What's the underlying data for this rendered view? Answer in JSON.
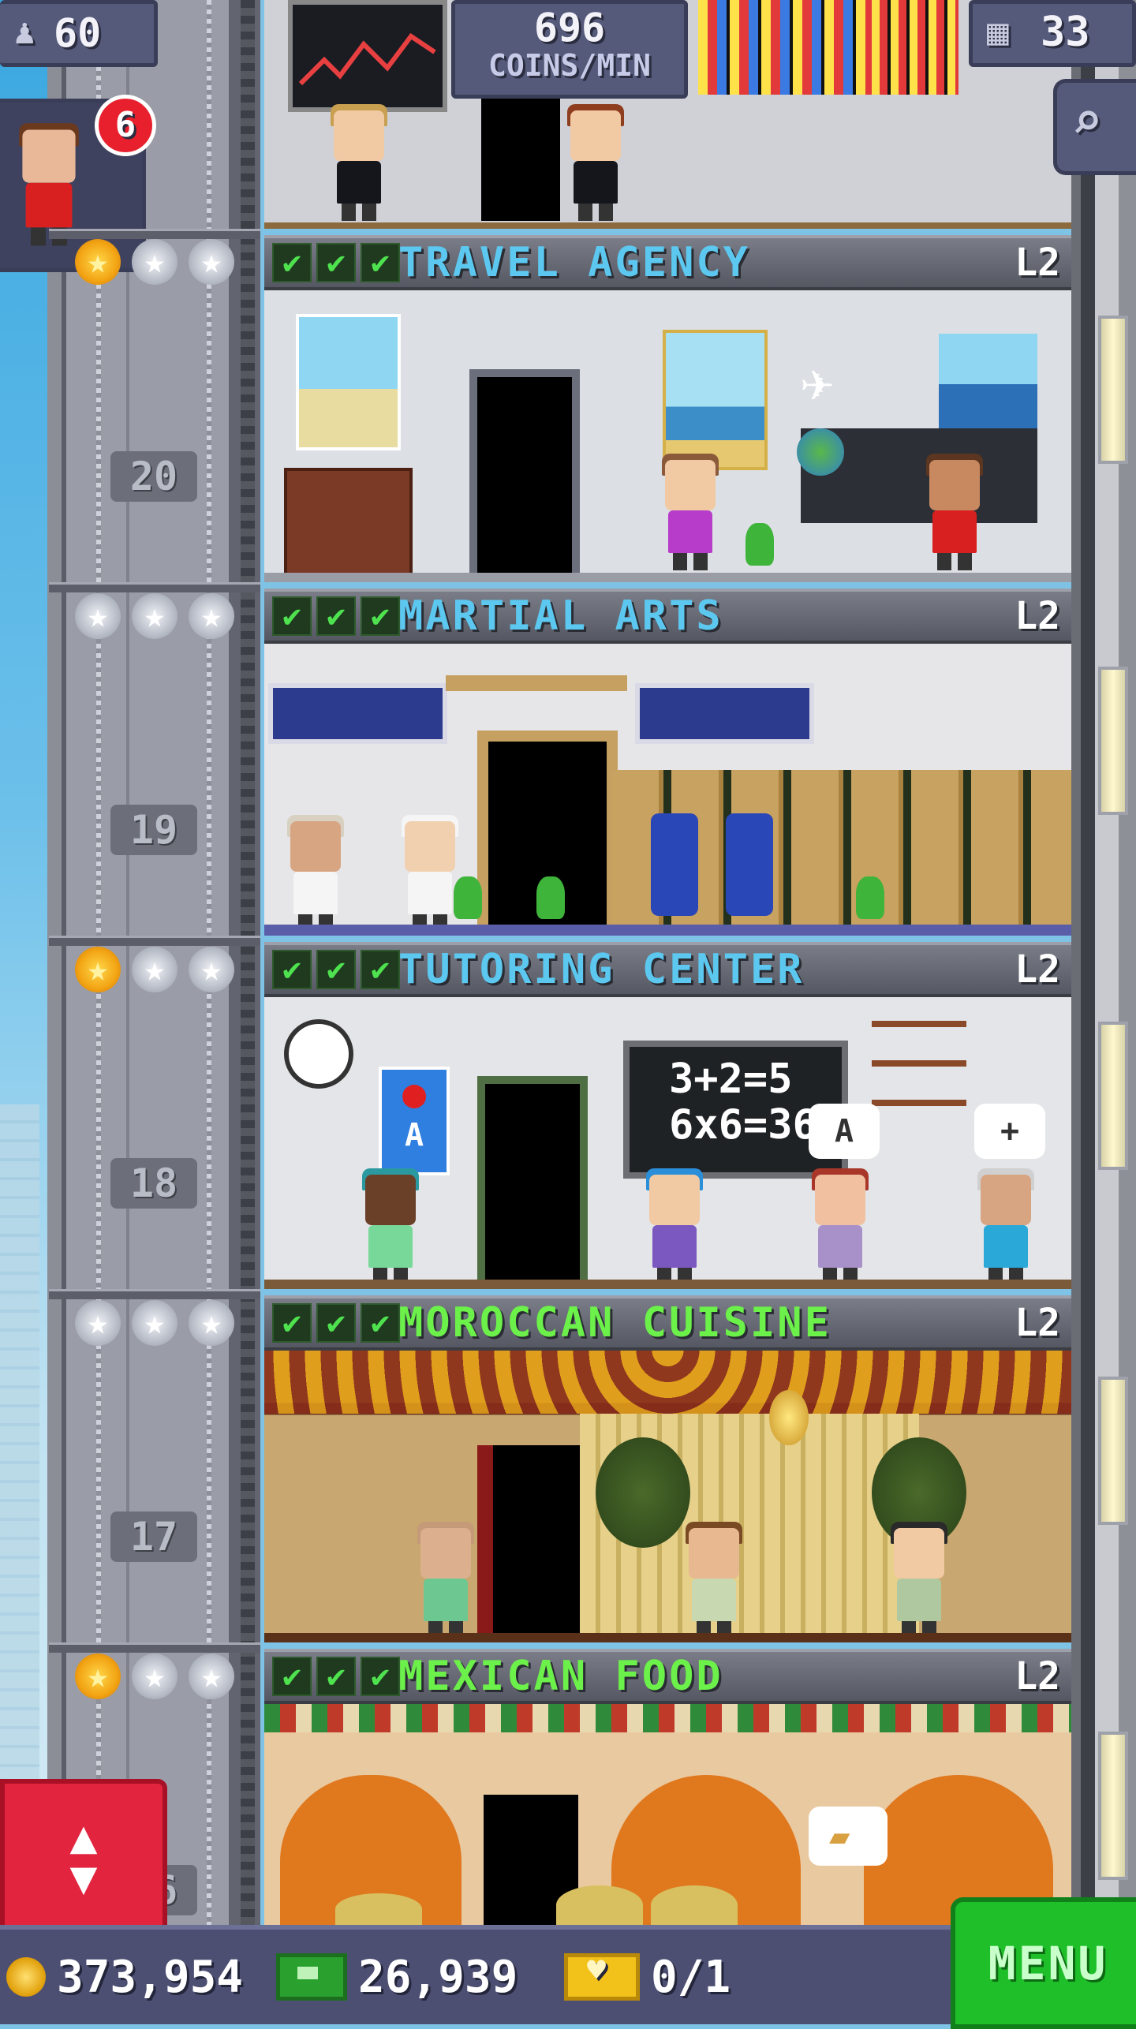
{
  "hud": {
    "population": "60",
    "coins_per_min_value": "696",
    "coins_per_min_label": "COINS/MIN",
    "floors": "33",
    "notification_count": "6"
  },
  "floors": [
    {
      "name": "TRAVEL AGENCY",
      "level": "L2",
      "number": "20",
      "name_color": "#5cc8f0",
      "gold_stars": 1,
      "silver_stars": 2
    },
    {
      "name": "MARTIAL ARTS",
      "level": "L2",
      "number": "19",
      "name_color": "#5cc8f0",
      "gold_stars": 0,
      "silver_stars": 3
    },
    {
      "name": "TUTORING CENTER",
      "level": "L2",
      "number": "18",
      "name_color": "#5cc8f0",
      "gold_stars": 1,
      "silver_stars": 2
    },
    {
      "name": "MOROCCAN CUISINE",
      "level": "L2",
      "number": "17",
      "name_color": "#6cf04a",
      "gold_stars": 0,
      "silver_stars": 3
    },
    {
      "name": "MEXICAN FOOD",
      "level": "L2",
      "number": "16",
      "name_color": "#6cf04a",
      "gold_stars": 1,
      "silver_stars": 2
    }
  ],
  "tutoring": {
    "board_line1": "3+2=5",
    "board_line2": "6x6=36",
    "bubble1": "A",
    "bubble2": "+",
    "poster_letter": "A"
  },
  "bottom": {
    "coins": "373,954",
    "bux": "26,939",
    "tickets": "0/1",
    "menu_label": "MENU"
  },
  "colors": {
    "accent_green": "#1fbf2a",
    "alert_red": "#e2243f",
    "hud_bg": "#555a7a"
  }
}
